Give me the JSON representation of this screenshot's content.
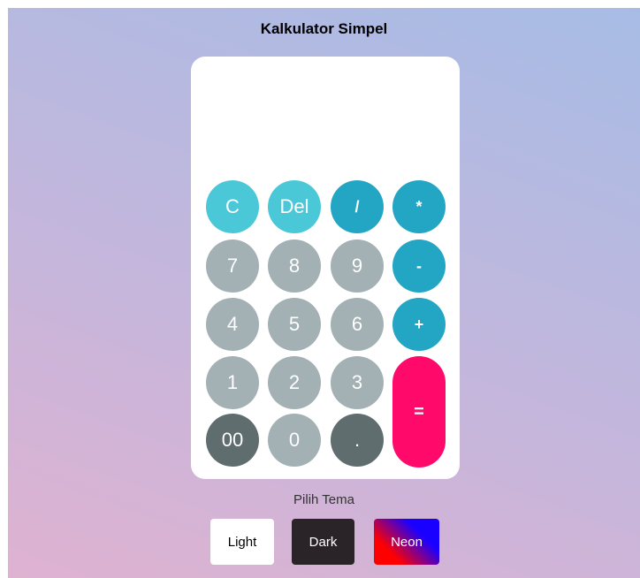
{
  "app": {
    "title": "Kalkulator Simpel"
  },
  "display": {
    "value": ""
  },
  "keys": {
    "clear": "C",
    "del": "Del",
    "divide": "/",
    "multiply": "*",
    "seven": "7",
    "eight": "8",
    "nine": "9",
    "minus": "-",
    "four": "4",
    "five": "5",
    "six": "6",
    "plus": "+",
    "one": "1",
    "two": "2",
    "three": "3",
    "equals": "=",
    "double_zero": "00",
    "zero": "0",
    "dot": "."
  },
  "theme": {
    "label": "Pilih Tema",
    "options": [
      "Light",
      "Dark",
      "Neon"
    ]
  },
  "colors": {
    "top_keys": "#4ac8d8",
    "operator_keys": "#22a6c4",
    "number_keys": "#a3b1b5",
    "dark_keys": "#5f6d6f",
    "equals_key": "#ff0a6b",
    "dark_theme_button": "#2a2327"
  }
}
